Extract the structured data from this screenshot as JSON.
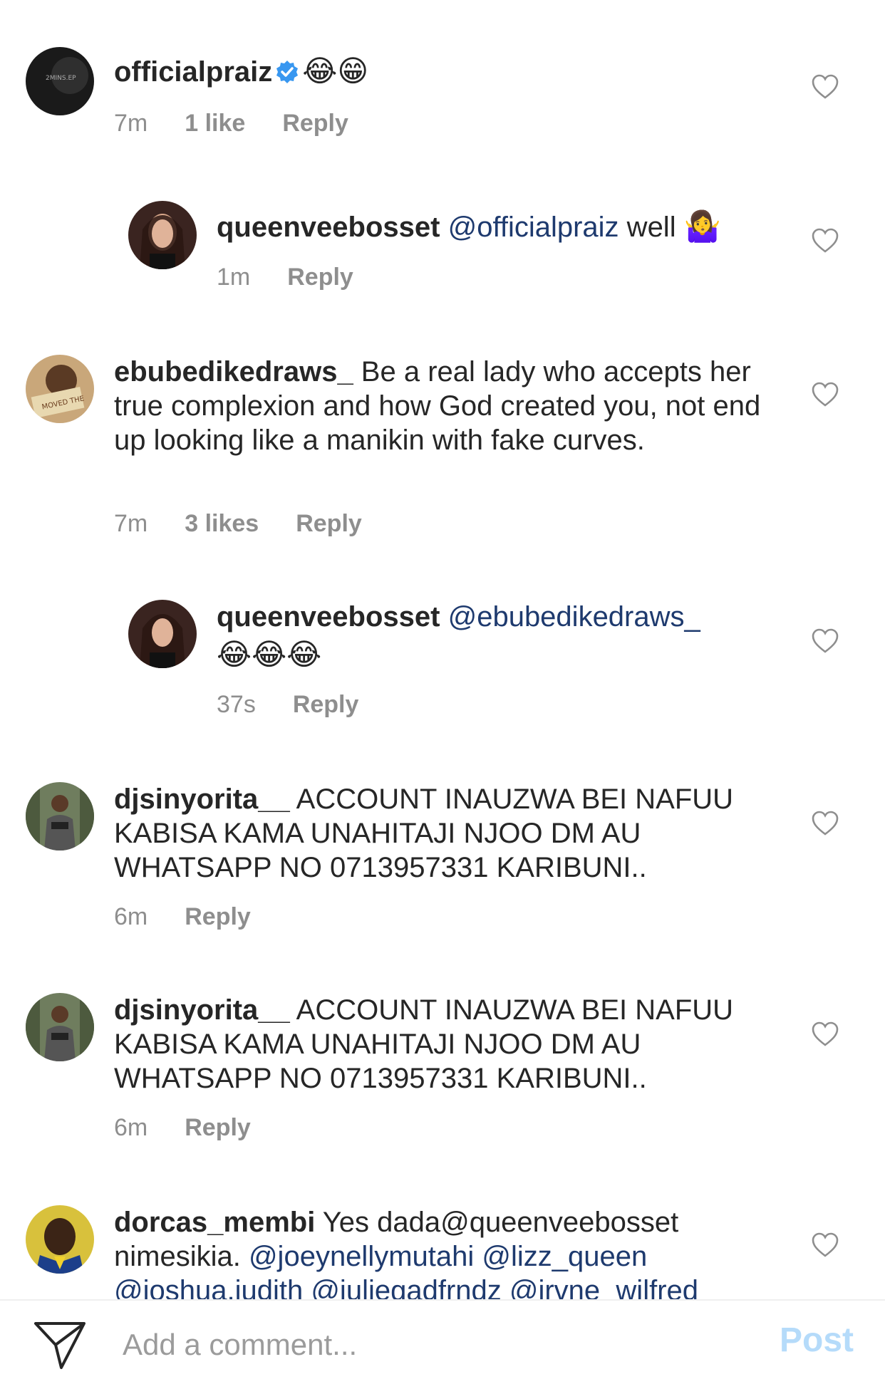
{
  "comments": [
    {
      "username": "officialpraiz",
      "verified": true,
      "mention": "",
      "text": "",
      "emoji": "😂😁",
      "time": "7m",
      "likes": "1 like",
      "reply": "Reply"
    },
    {
      "username": "queenveebosset",
      "verified": false,
      "mention": "@officialpraiz",
      "text": " well ",
      "emoji": "🤷‍♀️",
      "time": "1m",
      "likes": "",
      "reply": "Reply"
    },
    {
      "username": "ebubedikedraws_",
      "verified": false,
      "mention": "",
      "text": " Be a real lady who accepts her true complexion and how God created you, not end up looking like a manikin with fake curves.",
      "emoji": "",
      "time": "7m",
      "likes": "3 likes",
      "reply": "Reply"
    },
    {
      "username": "queenveebosset",
      "verified": false,
      "mention": "@ebubedikedraws_",
      "text": "",
      "emoji": "😂😂😂",
      "time": "37s",
      "likes": "",
      "reply": "Reply"
    },
    {
      "username": "djsinyorita__",
      "verified": false,
      "mention": "",
      "text": " ACCOUNT INAUZWA BEI NAFUU KABISA KAMA UNAHITAJI NJOO DM AU WHATSAPP NO 0713957331 KARIBUNI..",
      "emoji": "",
      "time": "6m",
      "likes": "",
      "reply": "Reply"
    },
    {
      "username": "djsinyorita__",
      "verified": false,
      "mention": "",
      "text": " ACCOUNT INAUZWA BEI NAFUU KABISA KAMA UNAHITAJI NJOO DM AU WHATSAPP NO 0713957331 KARIBUNI..",
      "emoji": "",
      "time": "6m",
      "likes": "",
      "reply": "Reply"
    },
    {
      "username": "dorcas_membi",
      "verified": false,
      "mention": "",
      "text": " Yes dada@queenveebosset nimesikia. ",
      "mentions_after": "@joeynellymutahi @lizz_queen @joshua.judith @juliegadfrndz @irvne_wilfred",
      "emoji": "",
      "time": "",
      "likes": "",
      "reply": ""
    }
  ],
  "composer": {
    "placeholder": "Add a comment...",
    "post_label": "Post",
    "send_icon": "paper-plane-icon"
  },
  "colors": {
    "text": "#262626",
    "meta": "#8e8e8e",
    "mention": "#1e3a6e",
    "verified": "#3897f0",
    "post_disabled": "#b5dbfa"
  }
}
